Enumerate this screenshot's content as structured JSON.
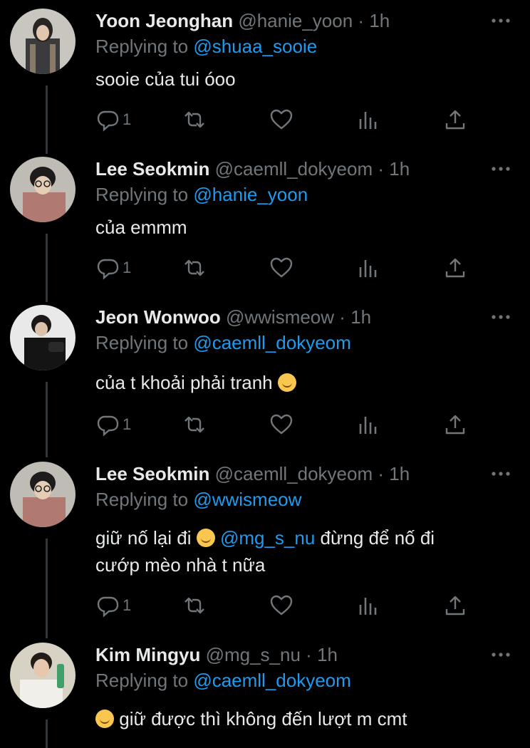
{
  "tweets": [
    {
      "name": "Yoon Jeonghan",
      "handle": "@hanie_yoon",
      "time": "1h",
      "replying_label": "Replying to",
      "replying_to": "@shuaa_sooie",
      "text": "sooie của tui óoo",
      "reply_count": "1"
    },
    {
      "name": "Lee Seokmin",
      "handle": "@caemll_dokyeom",
      "time": "1h",
      "replying_label": "Replying to",
      "replying_to": "@hanie_yoon",
      "text": "của emmm",
      "reply_count": "1"
    },
    {
      "name": "Jeon Wonwoo",
      "handle": "@wwismeow",
      "time": "1h",
      "replying_label": "Replying to",
      "replying_to": "@caemll_dokyeom",
      "text": "của t khoải phải tranh",
      "reply_count": "1"
    },
    {
      "name": "Lee Seokmin",
      "handle": "@caemll_dokyeom",
      "time": "1h",
      "replying_label": "Replying to",
      "replying_to": "@wwismeow",
      "text_a": "giữ nố lại đi",
      "text_mention": "@mg_s_nu",
      "text_b": "đừng để nố đi",
      "text_line2": "cướp mèo nhà t nữa",
      "reply_count": "1"
    },
    {
      "name": "Kim Mingyu",
      "handle": "@mg_s_nu",
      "time": "1h",
      "replying_label": "Replying to",
      "replying_to": "@caemll_dokyeom",
      "text": "giữ được thì không đến lượt m cmt"
    }
  ],
  "separator": "·",
  "colors": {
    "background": "#000000",
    "text": "#e7e9ea",
    "muted": "#71767b",
    "link": "#1d9bf0"
  },
  "icons": [
    "reply-icon",
    "retweet-icon",
    "like-icon",
    "analytics-icon",
    "share-icon",
    "more-icon"
  ]
}
